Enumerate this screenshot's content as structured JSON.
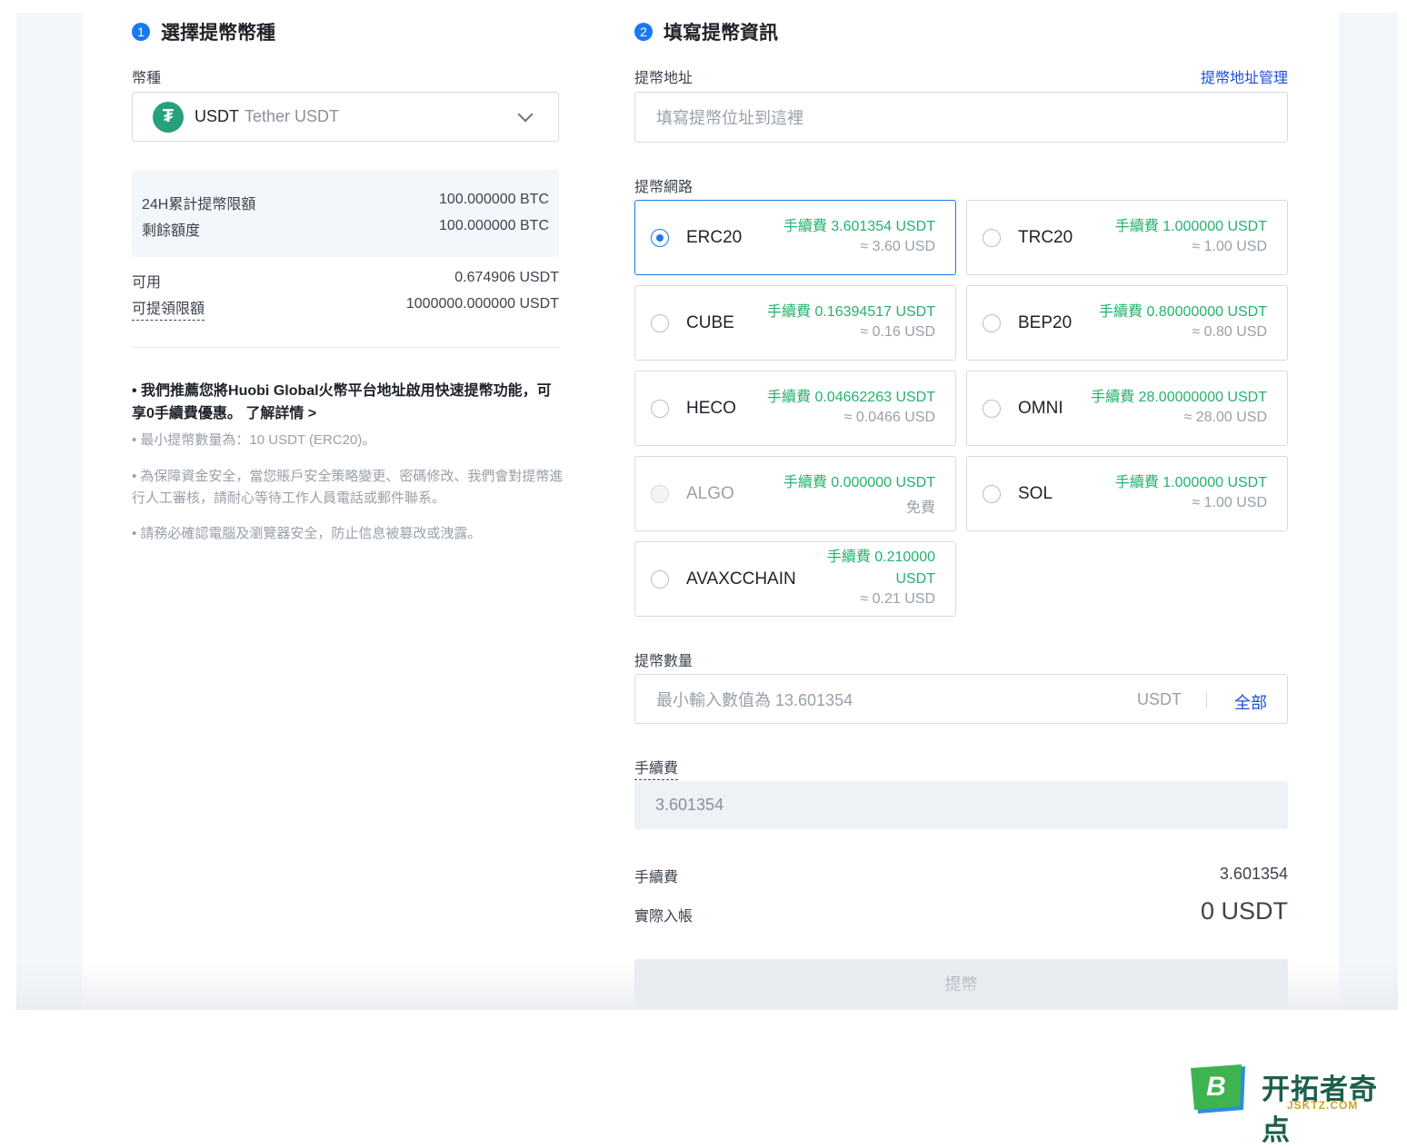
{
  "step1": {
    "number": "1",
    "title": "選擇提幣幣種"
  },
  "step2": {
    "number": "2",
    "title": "填寫提幣資訊"
  },
  "coin": {
    "label": "幣種",
    "code": "USDT",
    "name": "Tether USDT",
    "icon": "tether-icon",
    "accent": "#26a17b"
  },
  "limits": {
    "daily_label": "24H累計提幣限額",
    "daily_value": "100.000000 BTC",
    "remaining_label": "剩餘額度",
    "remaining_value": "100.000000 BTC"
  },
  "balance": {
    "available_label": "可用",
    "available_value": "0.674906 USDT",
    "withdrawable_label": "可提領限額",
    "withdrawable_value": "1000000.000000 USDT"
  },
  "notes": {
    "promo": "• 我們推薦您將Huobi Global火幣平台地址啟用快速提幣功能，可享0手續費優惠。 了解詳情 >",
    "min": "• 最小提幣數量為：10 USDT (ERC20)。",
    "security": "• 為保障資金安全，當您賬戶安全策略變更、密碼修改、我們會對提幣進行人工審核，請耐心等待工作人員電話或郵件聯系。",
    "device": "• 請務必確認電腦及瀏覽器安全，防止信息被篡改或洩露。"
  },
  "address": {
    "label": "提幣地址",
    "manage_link": "提幣地址管理",
    "placeholder": "填寫提幣位址到這裡"
  },
  "network": {
    "label": "提幣網路",
    "selected": "ERC20",
    "options": [
      {
        "name": "ERC20",
        "fee": "手續費 3.601354 USDT",
        "usd": "≈ 3.60 USD"
      },
      {
        "name": "TRC20",
        "fee": "手續費 1.000000 USDT",
        "usd": "≈ 1.00 USD"
      },
      {
        "name": "CUBE",
        "fee": "手續費 0.16394517 USDT",
        "usd": "≈ 0.16 USD"
      },
      {
        "name": "BEP20",
        "fee": "手續費 0.80000000 USDT",
        "usd": "≈ 0.80 USD"
      },
      {
        "name": "HECO",
        "fee": "手續費 0.04662263 USDT",
        "usd": "≈ 0.0466 USD"
      },
      {
        "name": "OMNI",
        "fee": "手續費 28.00000000 USDT",
        "usd": "≈ 28.00 USD"
      },
      {
        "name": "ALGO",
        "fee": "手續費 0.000000 USDT",
        "usd": "免費"
      },
      {
        "name": "SOL",
        "fee": "手續費 1.000000 USDT",
        "usd": "≈ 1.00 USD"
      },
      {
        "name": "AVAXCCHAIN",
        "fee_line1": "手續費 0.210000",
        "fee_line2": "USDT",
        "usd": "≈ 0.21 USD"
      }
    ]
  },
  "amount": {
    "label": "提幣數量",
    "placeholder": "最小輸入數值為 13.601354",
    "unit": "USDT",
    "all_button": "全部"
  },
  "fee_field": {
    "label": "手續費",
    "value": "3.601354"
  },
  "summary": {
    "fee_label": "手續費",
    "fee_value": "3.601354",
    "received_label": "實際入帳",
    "received_value": "0 USDT"
  },
  "submit_label": "提幣",
  "watermark": {
    "text": "开拓者奇点",
    "sub": "JSKTZ.COM",
    "logo_letter": "B"
  }
}
